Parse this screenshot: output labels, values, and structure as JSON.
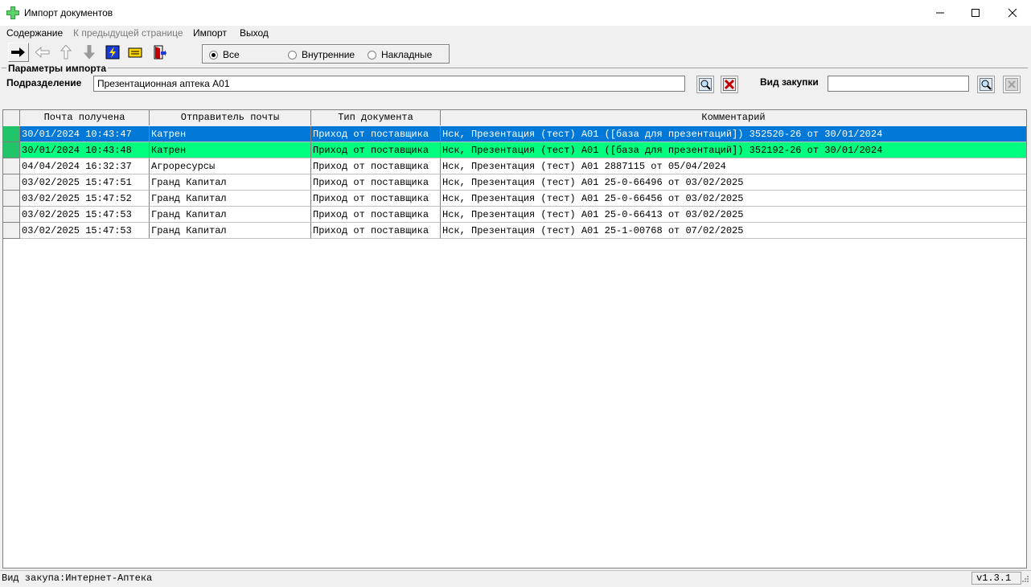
{
  "window": {
    "title": "Импорт документов",
    "minimize": "—",
    "maximize": "☐",
    "close": "✕"
  },
  "menu": [
    "Содержание",
    "К предыдущей странице",
    "Импорт",
    "Выход"
  ],
  "filter": {
    "options": [
      "Все",
      "Внутренние",
      "Накладные"
    ],
    "selected": "Все"
  },
  "params": {
    "legend": "Параметры импорта",
    "division_label": "Подразделение",
    "division_value": "Презентационная аптека А01",
    "purchase_type_label": "Вид закупки",
    "purchase_type_value": ""
  },
  "table": {
    "columns": [
      "Почта получена",
      "Отправитель почты",
      "Тип документа",
      "Комментарий"
    ],
    "rows": [
      {
        "received": "30/01/2024 10:43:47",
        "sender": "Катрен",
        "doc_type": "Приход от поставщика",
        "comment": "Нск, Презентация (тест) А01 ([база для презентаций]) 352520-26 от 30/01/2024"
      },
      {
        "received": "30/01/2024 10:43:48",
        "sender": "Катрен",
        "doc_type": "Приход от поставщика",
        "comment": "Нск, Презентация (тест) А01 ([база для презентаций]) 352192-26 от 30/01/2024"
      },
      {
        "received": "04/04/2024 16:32:37",
        "sender": "Агроресурсы",
        "doc_type": "Приход от поставщика",
        "comment": "Нск, Презентация (тест) А01 2887115 от 05/04/2024"
      },
      {
        "received": "03/02/2025 15:47:51",
        "sender": "Гранд Капитал",
        "doc_type": "Приход от поставщика",
        "comment": "Нск, Презентация (тест) А01 25-0-66496 от 03/02/2025"
      },
      {
        "received": "03/02/2025 15:47:52",
        "sender": "Гранд Капитал",
        "doc_type": "Приход от поставщика",
        "comment": "Нск, Презентация (тест) А01 25-0-66456 от 03/02/2025"
      },
      {
        "received": "03/02/2025 15:47:53",
        "sender": "Гранд Капитал",
        "doc_type": "Приход от поставщика",
        "comment": "Нск, Презентация (тест) А01 25-0-66413 от 03/02/2025"
      },
      {
        "received": "03/02/2025 15:47:53",
        "sender": "Гранд Капитал",
        "doc_type": "Приход от поставщика",
        "comment": "Нск, Презентация (тест) А01 25-1-00768 от 07/02/2025"
      }
    ]
  },
  "status": {
    "text": "Вид закупа:Интернет-Аптека",
    "version": "v1.3.1"
  },
  "colors": {
    "selected_row": "#0078d7",
    "highlight_row": "#00ff7f",
    "indicator": "#22c46a"
  }
}
